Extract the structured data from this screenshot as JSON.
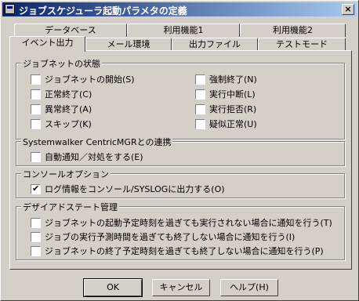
{
  "window": {
    "title": "ジョブスケジューラ起動パラメタの定義",
    "close_label": "×"
  },
  "tabs_back": [
    {
      "label": "データベース"
    },
    {
      "label": "利用機能1"
    },
    {
      "label": "利用機能2"
    }
  ],
  "tabs_front": [
    {
      "label": "イベント出力"
    },
    {
      "label": "メール環境"
    },
    {
      "label": "出力ファイル"
    },
    {
      "label": "テストモード"
    }
  ],
  "jobnet_state": {
    "legend": "ジョブネットの状態",
    "items": [
      {
        "label": "ジョブネットの開始(S)",
        "checked": false
      },
      {
        "label": "正常終了(C)",
        "checked": false
      },
      {
        "label": "異常終了(A)",
        "checked": false
      },
      {
        "label": "スキップ(K)",
        "checked": false
      },
      {
        "label": "強制終了(N)",
        "checked": false
      },
      {
        "label": "実行中断(L)",
        "checked": false
      },
      {
        "label": "実行拒否(R)",
        "checked": false
      },
      {
        "label": "疑似正常(U)",
        "checked": false
      }
    ]
  },
  "centric": {
    "legend": "Systemwalker CentricMGRとの連携",
    "items": [
      {
        "label": "自動通知／対処をする(E)",
        "checked": false
      }
    ]
  },
  "console": {
    "legend": "コンソールオプション",
    "items": [
      {
        "label": "ログ情報をコンソール/SYSLOGに出力する(O)",
        "checked": true
      }
    ]
  },
  "deadline": {
    "legend": "デザイアドステート管理",
    "items": [
      {
        "label": "ジョブネットの起動予定時刻を過ぎても実行されない場合に通知を行う(T)",
        "checked": false
      },
      {
        "label": "ジョブの実行予測時間を過ぎても終了しない場合に通知を行う(I)",
        "checked": false
      },
      {
        "label": "ジョブネットの終了予定時刻を過ぎても終了しない場合に通知を行う(P)",
        "checked": false
      }
    ]
  },
  "buttons": {
    "ok": "OK",
    "cancel": "キャンセル",
    "help": "ヘルプ(H)"
  }
}
